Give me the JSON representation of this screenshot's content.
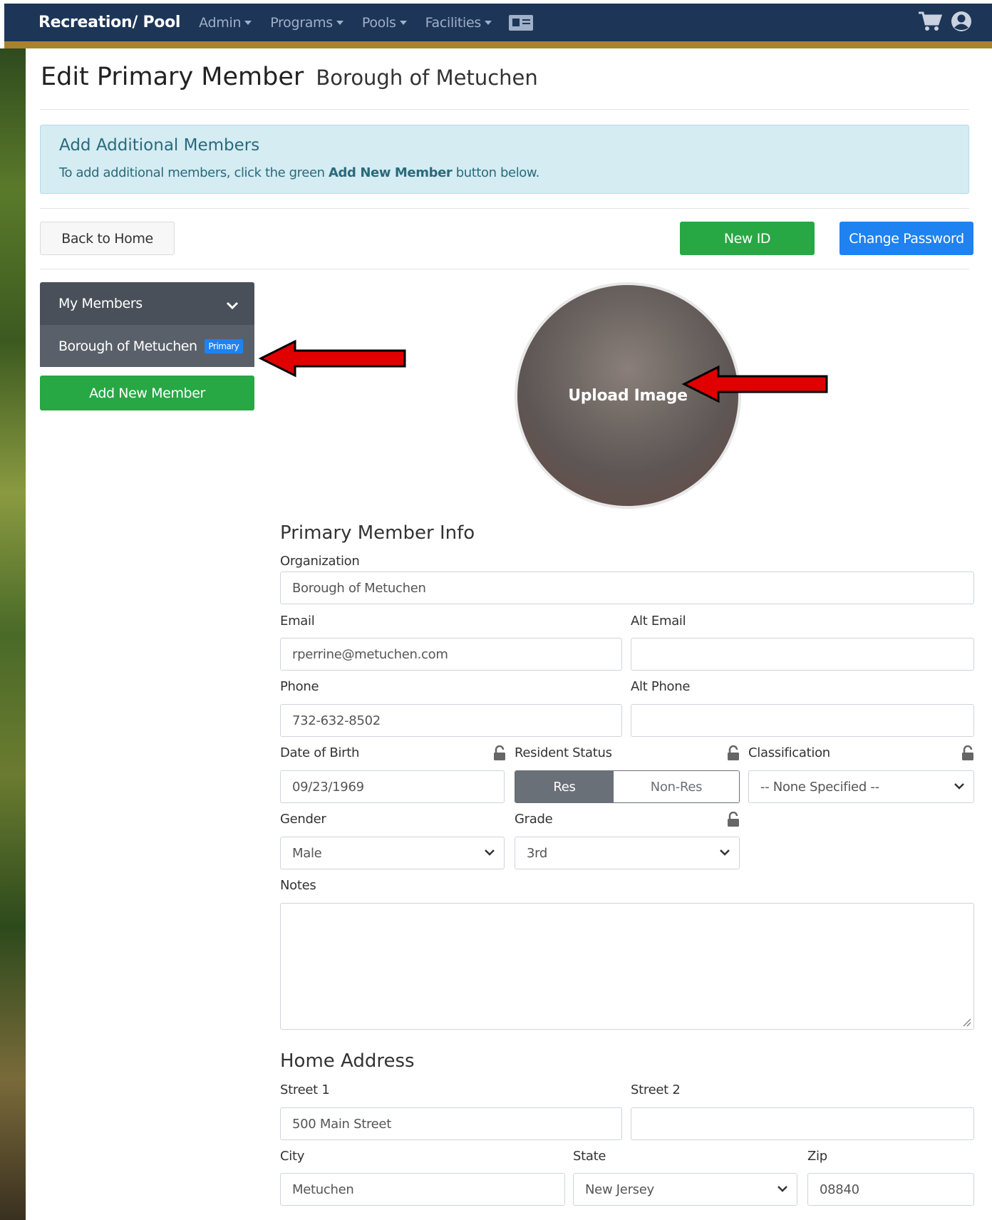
{
  "nav": {
    "brand": "Recreation/ Pool",
    "items": [
      "Admin",
      "Programs",
      "Pools",
      "Facilities"
    ],
    "icons": [
      "id-card-icon",
      "cart-icon",
      "user-icon"
    ]
  },
  "page": {
    "title": "Edit Primary Member",
    "subtitle": "Borough of Metuchen"
  },
  "alert": {
    "title": "Add Additional Members",
    "text_before": "To add additional members, click the green",
    "text_bold": "Add New Member",
    "text_after": "button below."
  },
  "buttons": {
    "back_home": "Back to Home",
    "new_id": "New ID",
    "change_password": "Change Password",
    "add_new_member": "Add New Member"
  },
  "members": {
    "header": "My Members",
    "items": [
      {
        "name": "Borough of Metuchen",
        "badge": "Primary"
      }
    ]
  },
  "avatar": {
    "label": "Upload Image"
  },
  "primary_info": {
    "section_title": "Primary Member Info",
    "organization_label": "Organization",
    "organization_value": "Borough of Metuchen",
    "email_label": "Email",
    "email_value": "rperrine@metuchen.com",
    "alt_email_label": "Alt Email",
    "alt_email_value": "",
    "phone_label": "Phone",
    "phone_value": "732-632-8502",
    "alt_phone_label": "Alt Phone",
    "alt_phone_value": "",
    "dob_label": "Date of Birth",
    "dob_value": "09/23/1969",
    "resident_label": "Resident Status",
    "resident_options": [
      "Res",
      "Non-Res"
    ],
    "resident_selected": "Res",
    "classification_label": "Classification",
    "classification_value": "-- None Specified --",
    "gender_label": "Gender",
    "gender_value": "Male",
    "grade_label": "Grade",
    "grade_value": "3rd",
    "notes_label": "Notes",
    "notes_value": ""
  },
  "address": {
    "section_title": "Home Address",
    "street1_label": "Street 1",
    "street1_value": "500 Main Street",
    "street2_label": "Street 2",
    "street2_value": "",
    "city_label": "City",
    "city_value": "Metuchen",
    "state_label": "State",
    "state_value": "New Jersey",
    "zip_label": "Zip",
    "zip_value": "08840"
  },
  "colors": {
    "navbar": "#1d3557",
    "nav_accent": "#a9822e",
    "success": "#28a745",
    "primary": "#1e82f0",
    "alert_bg": "#d4ecf2",
    "arrow": "#e00000"
  }
}
